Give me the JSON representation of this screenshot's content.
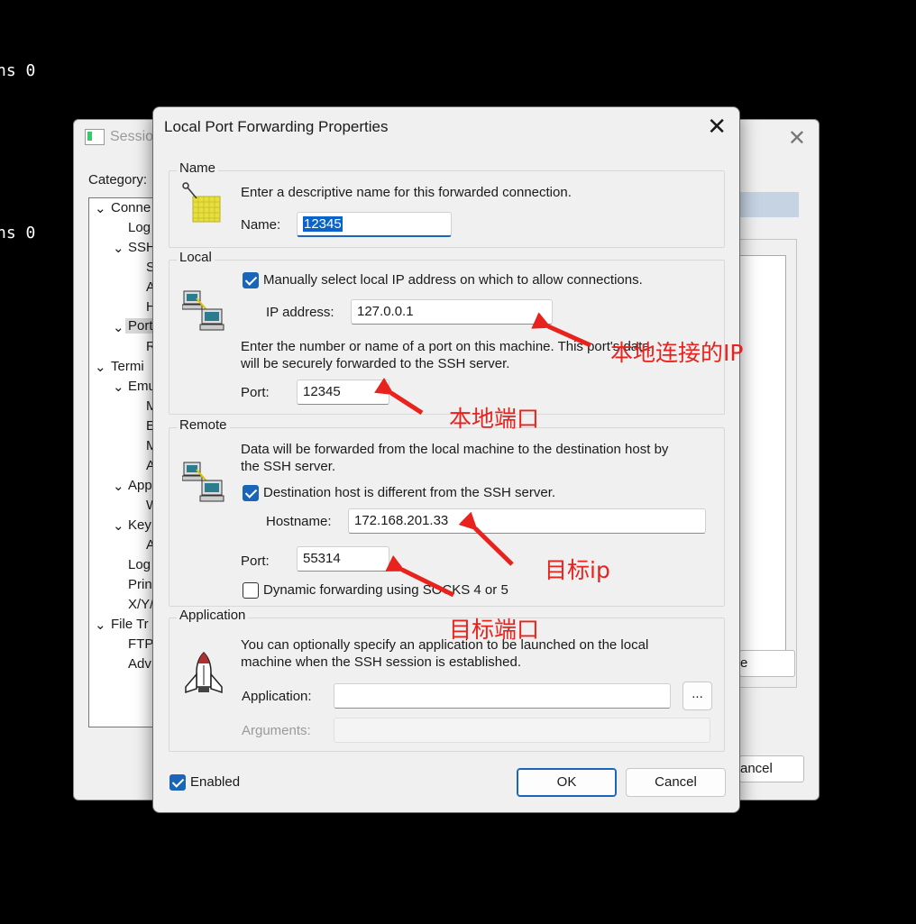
{
  "terminal": {
    "line1": "ns 0",
    "line2": "ns 0"
  },
  "background_window": {
    "title": "Sessio",
    "category_label": "Category:",
    "tree": [
      "Conne",
      "Log",
      "SSH",
      "S",
      "A",
      "H",
      "Port",
      "R",
      "Termi",
      "Emu",
      "M",
      "E",
      "M",
      "A",
      "App",
      "W",
      "Key",
      "A",
      "Log",
      "Prin",
      "X/Y/",
      "File Tr",
      "FTP",
      "Adv"
    ],
    "right_button": "e",
    "cancel_button": "ancel"
  },
  "dialog": {
    "title": "Local Port Forwarding Properties",
    "name_group": {
      "label": "Name",
      "description": "Enter a descriptive name for this forwarded connection.",
      "name_label": "Name:",
      "name_value": "12345"
    },
    "local_group": {
      "label": "Local",
      "manual_checkbox_label": "Manually select local IP address on which to allow connections.",
      "ip_label": "IP address:",
      "ip_value": "127.0.0.1",
      "description_line1": "Enter the number or name of a port on this machine.  This port's data",
      "description_line2": "will be securely forwarded to the SSH server.",
      "port_label": "Port:",
      "port_value": "12345"
    },
    "remote_group": {
      "label": "Remote",
      "description_line1": "Data will be forwarded from the local machine to the destination host by",
      "description_line2": "the SSH server.",
      "dest_checkbox_label": "Destination host is different from the SSH server.",
      "hostname_label": "Hostname:",
      "hostname_value": "172.168.201.33",
      "port_label": "Port:",
      "port_value": "55314",
      "dynamic_checkbox_label": "Dynamic forwarding using SOCKS 4 or 5"
    },
    "application_group": {
      "label": "Application",
      "description_line1": "You can optionally specify an application to be launched on the local",
      "description_line2": "machine when the SSH session is established.",
      "application_label": "Application:",
      "application_value": "",
      "browse_label": "...",
      "arguments_label": "Arguments:",
      "arguments_value": ""
    },
    "enabled_label": "Enabled",
    "ok_label": "OK",
    "cancel_label": "Cancel"
  },
  "annotations": {
    "local_ip": "本地连接的IP",
    "local_port": "本地端口",
    "target_ip": "目标ip",
    "target_port": "目标端口"
  },
  "colors": {
    "accent": "#1a65b7",
    "annotation": "#e8221d",
    "selection": "#0a64c8"
  }
}
